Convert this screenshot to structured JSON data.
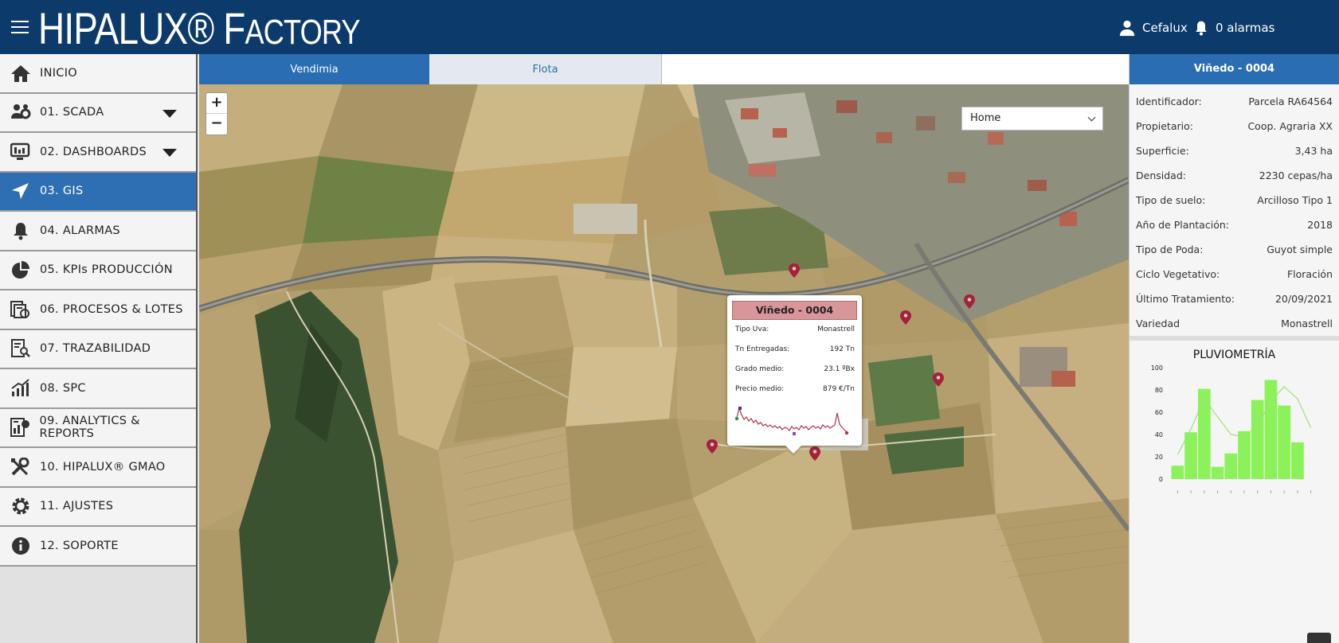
{
  "header": {
    "logo_main": "HIPALUX® F",
    "logo_tail": "ACTORY",
    "user_name": "Cefalux",
    "alarms_label": "0 alarmas"
  },
  "sidebar": {
    "items": [
      {
        "label": "INICIO",
        "icon": "home-icon",
        "active": false,
        "expandable": false
      },
      {
        "label": "01. SCADA",
        "icon": "users-gear-icon",
        "active": false,
        "expandable": true
      },
      {
        "label": "02. DASHBOARDS",
        "icon": "dashboard-icon",
        "active": false,
        "expandable": true
      },
      {
        "label": "03. GIS",
        "icon": "navigation-icon",
        "active": true,
        "expandable": false
      },
      {
        "label": "04. ALARMAS",
        "icon": "bell-icon",
        "active": false,
        "expandable": false
      },
      {
        "label": "05. KPIs PRODUCCIÓN",
        "icon": "pie-chart-icon",
        "active": false,
        "expandable": false
      },
      {
        "label": "06. PROCESOS & LOTES",
        "icon": "batches-icon",
        "active": false,
        "expandable": false
      },
      {
        "label": "07. TRAZABILIDAD",
        "icon": "document-search-icon",
        "active": false,
        "expandable": false
      },
      {
        "label": "08. SPC",
        "icon": "trend-chart-icon",
        "active": false,
        "expandable": false
      },
      {
        "label": "09. ANALYTICS & REPORTS",
        "icon": "report-icon",
        "active": false,
        "expandable": false
      },
      {
        "label": "10. HIPALUX® GMAO",
        "icon": "tools-icon",
        "active": false,
        "expandable": false
      },
      {
        "label": "11. AJUSTES",
        "icon": "gear-icon",
        "active": false,
        "expandable": false
      },
      {
        "label": "12. SOPORTE",
        "icon": "info-icon",
        "active": false,
        "expandable": false
      }
    ]
  },
  "tabs": [
    {
      "label": "Vendimia"
    },
    {
      "label": "Flota"
    }
  ],
  "map": {
    "zoom_in": "+",
    "zoom_out": "−",
    "view_select": "Home",
    "popup": {
      "title": "Viñedo - 0004",
      "rows": [
        {
          "label": "Tipo Uva:",
          "value": "Monastrell"
        },
        {
          "label": "Tn Entregadas:",
          "value": "192 Tn"
        },
        {
          "label": "Grado medio:",
          "value": "23.1 ºBx"
        },
        {
          "label": "Precio medio:",
          "value": "879 €/Tn"
        }
      ]
    },
    "marker_color": "#a3213a"
  },
  "details": {
    "title": "Viñedo - 0004",
    "rows": [
      {
        "label": "Identificador:",
        "value": "Parcela RA64564"
      },
      {
        "label": "Propietario:",
        "value": "Coop. Agraria XX"
      },
      {
        "label": "Superficie:",
        "value": "3,43 ha"
      },
      {
        "label": "Densidad:",
        "value": "2230 cepas/ha"
      },
      {
        "label": "Tipo de suelo:",
        "value": "Arcilloso Tipo 1"
      },
      {
        "label": "Año de Plantación:",
        "value": "2018"
      },
      {
        "label": "Tipo de Poda:",
        "value": "Guyot simple"
      },
      {
        "label": "Ciclo Vegetativo:",
        "value": "Floración"
      },
      {
        "label": "Último Tratamiento:",
        "value": "20/09/2021"
      },
      {
        "label": "Variedad",
        "value": "Monastrell"
      }
    ]
  },
  "chart_data": {
    "type": "bar",
    "title": "PLUVIOMETRÍA",
    "categories": [
      "",
      "",
      "",
      "",
      "",
      "",
      "",
      "",
      "",
      "",
      ""
    ],
    "values": [
      12,
      42,
      81,
      11,
      23,
      43,
      71,
      89,
      66,
      33,
      0
    ],
    "line_values": [
      22,
      45,
      72,
      56,
      40,
      38,
      48,
      70,
      83,
      72,
      46
    ],
    "ylim": [
      0,
      100
    ],
    "yticks": [
      "100",
      "80",
      "60",
      "40",
      "20",
      "0"
    ],
    "bar_color": "#8cf25a",
    "line_color": "#9ee07a"
  },
  "colors": {
    "header_bg": "#0c3b6b",
    "accent": "#2a6db2",
    "popup_title_bg": "#d9969a"
  }
}
